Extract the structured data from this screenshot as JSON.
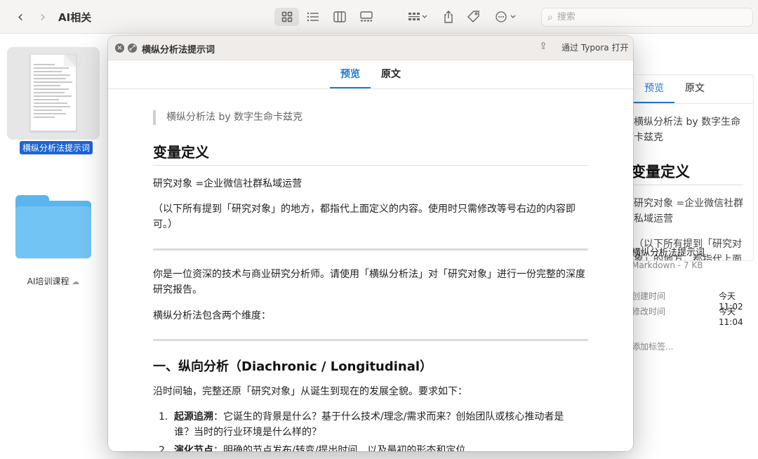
{
  "toolbar": {
    "title": "AI相关",
    "search_placeholder": "搜索"
  },
  "finder": {
    "files": [
      {
        "name": "横纵分析法提示词",
        "selected": true
      },
      {
        "name": "AI培训课程",
        "cloud": true
      }
    ]
  },
  "right_pane": {
    "tabs": [
      "预览",
      "原文"
    ],
    "quote": "横纵分析法 by 数字生命卡兹克",
    "heading": "变量定义",
    "text1": "研究对象 =企业微信社群私域运营",
    "text2": "（以下所有提到「研究对象」的地方，都指代上面定义的内容。使用时只需修改等号右边的内容即可。）",
    "file_name": "横纵分析法提示词",
    "file_info": "Markdown - 7 KB",
    "created_label": "创建时间",
    "created_value": "今天 11:02",
    "modified_label": "修改时间",
    "modified_value": "今天 11:04",
    "tags_placeholder": "添加标签..."
  },
  "quicklook": {
    "title": "横纵分析法提示词",
    "open_with": "通过 Typora 打开",
    "tabs": [
      "预览",
      "原文"
    ],
    "active_tab": "预览",
    "doc": {
      "quote": "横纵分析法 by 数字生命卡兹克",
      "h_vars": "变量定义",
      "subject": "研究对象 =企业微信社群私域运营",
      "note": "（以下所有提到「研究对象」的地方，都指代上面定义的内容。使用时只需修改等号右边的内容即可。）",
      "intro": "你是一位资深的技术与商业研究分析师。请使用「横纵分析法」对「研究对象」进行一份完整的深度研究报告。",
      "dims": "横纵分析法包含两个维度：",
      "h_longitudinal": "一、纵向分析（Diachronic / Longitudinal）",
      "long_desc": "沿时间轴，完整还原「研究对象」从诞生到现在的发展全貌。要求如下：",
      "items": [
        {
          "num": "1.",
          "title": "起源追溯",
          "text": "：它诞生的背景是什么？基于什么技术/理念/需求而来？创始团队或核心推动者是谁？当时的行业环境是什么样的？"
        },
        {
          "num": "2.",
          "title": "演化节点",
          "text": "：明确的节点发布/转变/提出时间、以及最初的形态和定位"
        }
      ]
    }
  }
}
